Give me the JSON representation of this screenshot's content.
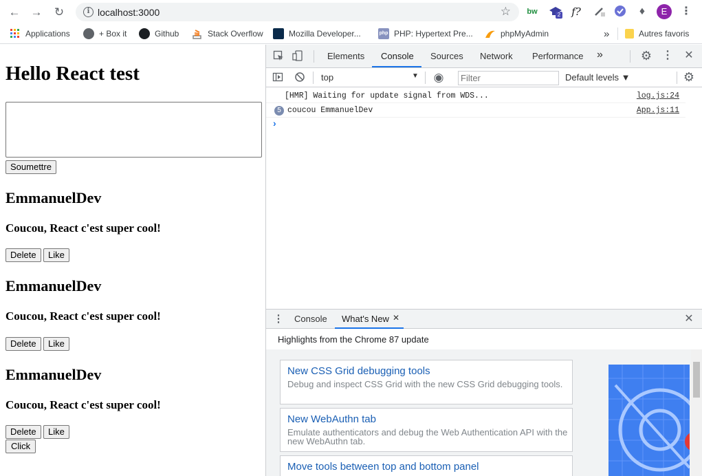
{
  "browser": {
    "url": "localhost:3000",
    "profile_initial": "E",
    "extension_badge": "2",
    "extensions": [
      "bw",
      "f?"
    ],
    "bookmarks": [
      {
        "label": "Applications",
        "icon": "apps-grid-icon"
      },
      {
        "label": "+ Box it",
        "icon": "globe-icon"
      },
      {
        "label": "Github",
        "icon": "github-icon"
      },
      {
        "label": "Stack Overflow",
        "icon": "stackoverflow-icon"
      },
      {
        "label": "Mozilla Developer...",
        "icon": "mozilla-icon"
      },
      {
        "label": "PHP: Hypertext Pre...",
        "icon": "php-icon"
      },
      {
        "label": "phpMyAdmin",
        "icon": "phpmyadmin-icon"
      }
    ],
    "more_bookmarks": "»",
    "other_bookmarks": "Autres favoris"
  },
  "page": {
    "title": "Hello React test",
    "submit_label": "Soumettre",
    "posts": [
      {
        "author": "EmmanuelDev",
        "message": "Coucou, React c'est super cool!",
        "delete_label": "Delete",
        "like_label": "Like"
      },
      {
        "author": "EmmanuelDev",
        "message": "Coucou, React c'est super cool!",
        "delete_label": "Delete",
        "like_label": "Like"
      },
      {
        "author": "EmmanuelDev",
        "message": "Coucou, React c'est super cool!",
        "delete_label": "Delete",
        "like_label": "Like"
      }
    ],
    "click_label": "Click"
  },
  "devtools": {
    "tabs": [
      "Elements",
      "Console",
      "Sources",
      "Network",
      "Performance"
    ],
    "active_tab": "Console",
    "more_tabs": "»",
    "context": "top",
    "filter_placeholder": "Filter",
    "levels": "Default levels ▼",
    "logs": [
      {
        "text": "[HMR] Waiting for update signal from WDS...",
        "source": "log.js:24",
        "count": ""
      },
      {
        "text": "coucou EmmanuelDev",
        "source": "App.js:11",
        "count": "5"
      }
    ],
    "prompt": "›",
    "drawer": {
      "tabs": [
        "Console",
        "What's New"
      ],
      "active_tab": "What's New",
      "close_tab_glyph": "✕",
      "heading": "Highlights from the Chrome 87 update",
      "cards": [
        {
          "title": "New CSS Grid debugging tools",
          "desc": "Debug and inspect CSS Grid with the new CSS Grid debugging tools."
        },
        {
          "title": "New WebAuthn tab",
          "desc": "Emulate authenticators and debug the Web Authentication API with the new WebAuthn tab."
        },
        {
          "title": "Move tools between top and bottom panel",
          "desc": ""
        }
      ]
    }
  },
  "colors": {
    "accent_blue": "#1a73e8",
    "profile_purple": "#8e24aa",
    "link_blue": "#1a5fb4"
  }
}
